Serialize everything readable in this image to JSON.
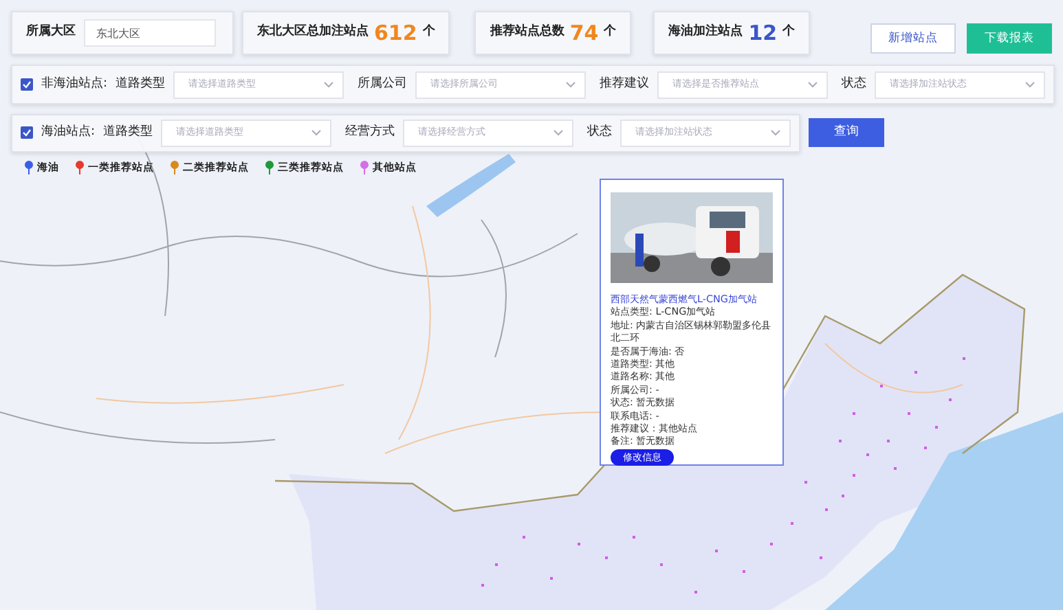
{
  "region_filter": {
    "label": "所属大区",
    "value": "东北大区"
  },
  "stats": [
    {
      "label": "东北大区总加注站点",
      "value": "612",
      "unit": "个",
      "color": "#f0871e"
    },
    {
      "label": "推荐站点总数",
      "value": "74",
      "unit": "个",
      "color": "#f0871e"
    },
    {
      "label": "海油加注站点",
      "value": "12",
      "unit": "个",
      "color": "#3a56c8"
    }
  ],
  "actions": [
    {
      "label": "新增站点",
      "kind": "outline"
    },
    {
      "label": "下载报表",
      "kind": "primary"
    }
  ],
  "filter_rows": [
    {
      "checked": true,
      "label": "非海油站点:",
      "fields": [
        {
          "label": "道路类型",
          "placeholder": "请选择道路类型"
        },
        {
          "label": "所属公司",
          "placeholder": "请选择所属公司"
        },
        {
          "label": "推荐建议",
          "placeholder": "请选择是否推荐站点"
        },
        {
          "label": "状态",
          "placeholder": "请选择加注站状态"
        }
      ]
    },
    {
      "checked": true,
      "label": "海油站点:",
      "fields": [
        {
          "label": "道路类型",
          "placeholder": "请选择道路类型"
        },
        {
          "label": "经营方式",
          "placeholder": "请选择经营方式"
        },
        {
          "label": "状态",
          "placeholder": "请选择加注站状态"
        }
      ],
      "button": "查询"
    }
  ],
  "legend": [
    {
      "label": "海油",
      "color": "#3b5ee8"
    },
    {
      "label": "一类推荐站点",
      "color": "#e8392c"
    },
    {
      "label": "二类推荐站点",
      "color": "#d98a1c"
    },
    {
      "label": "三类推荐站点",
      "color": "#1f9a3a"
    },
    {
      "label": "其他站点",
      "color": "#d66ee8"
    }
  ],
  "popup": {
    "title": "西部天然气蒙西燃气L-CNG加气站",
    "lines": [
      "站点类型: L-CNG加气站",
      "地址: 内蒙古自治区锡林郭勒盟多伦县北二环",
      "是否属于海油: 否",
      "道路类型: 其他",
      "道路名称: 其他",
      "所属公司: -",
      "状态: 暂无数据",
      "联系电话: -",
      "推荐建议：其他站点",
      "备注: 暂无数据"
    ],
    "button": "修改信息"
  }
}
